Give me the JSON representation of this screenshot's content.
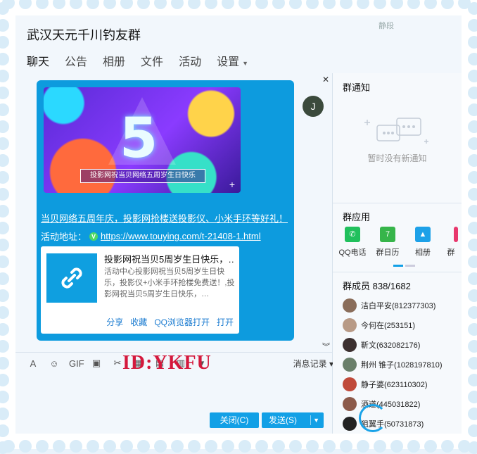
{
  "window": {
    "title": "武汉天元千川钓友群",
    "top_right": "静段"
  },
  "tabs": [
    {
      "label": "聊天"
    },
    {
      "label": "公告"
    },
    {
      "label": "相册"
    },
    {
      "label": "文件"
    },
    {
      "label": "活动"
    },
    {
      "label": "设置"
    }
  ],
  "chat": {
    "banner": {
      "big_text": "5",
      "caption": "投影网祝当贝网络五周岁生日快乐"
    },
    "avatar_letter": "J",
    "message_line1": "当贝网络五周年庆，投影网抢楼送投影仪、小米手环等好礼！",
    "message_line2_label": "活动地址：",
    "verified_badge": "V",
    "message_link": "https://www.touying.com/t-21408-1.html",
    "card": {
      "title": "投影网祝当贝5周岁生日快乐，…",
      "description": "活动中心投影网祝当贝5周岁生日快乐，投影仪+小米手环抢楼免费送！,投影网祝当贝5周岁生日快乐，…",
      "actions": [
        "分享",
        "收藏",
        "QQ浏览器打开",
        "打开"
      ]
    }
  },
  "toolbar": {
    "history_label": "消息记录"
  },
  "watermark": "ID:YKFU",
  "buttons": {
    "close_label": "关闭(C)",
    "send_label": "发送(S)"
  },
  "sidebar": {
    "notice_title": "群通知",
    "notice_empty": "暂时没有新通知",
    "apps_title": "群应用",
    "apps": [
      {
        "label": "QQ电话",
        "color": "#20c05c"
      },
      {
        "label": "群日历",
        "color": "#36b54a",
        "badge": "7"
      },
      {
        "label": "相册",
        "color": "#1da1e8"
      },
      {
        "label": "群",
        "color": "#e8386d"
      }
    ],
    "members_title": "群成员 838/1682",
    "members": [
      {
        "name": "洁白平安(812377303)"
      },
      {
        "name": "今何在(253151)"
      },
      {
        "name": "靳文(632082176)"
      },
      {
        "name": "荆州 锥子(1028197810)"
      },
      {
        "name": "静子婆(623110302)"
      },
      {
        "name": "酒道(445031822)"
      },
      {
        "name": "狙翼手(50731873)"
      }
    ]
  }
}
